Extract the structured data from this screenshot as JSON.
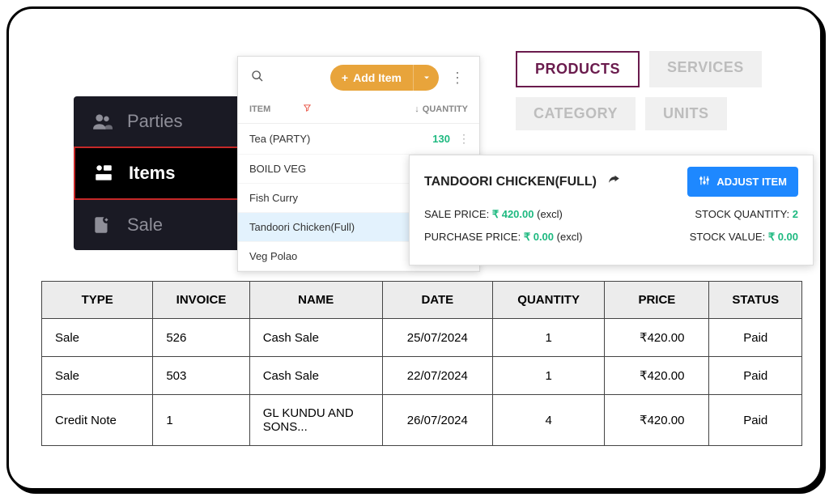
{
  "sidebar": {
    "items": [
      {
        "label": "Parties"
      },
      {
        "label": "Items"
      },
      {
        "label": "Sale"
      }
    ]
  },
  "itemPanel": {
    "addLabel": "Add Item",
    "headers": {
      "item": "ITEM",
      "quantity": "QUANTITY"
    },
    "rows": [
      {
        "name": "Tea (PARTY)",
        "qty": "130"
      },
      {
        "name": "BOILD VEG",
        "qty": ""
      },
      {
        "name": "Fish Curry",
        "qty": ""
      },
      {
        "name": "Tandoori Chicken(Full)",
        "qty": ""
      },
      {
        "name": "Veg Polao",
        "qty": ""
      }
    ]
  },
  "tabs": {
    "products": "PRODUCTS",
    "services": "SERVICES",
    "category": "CATEGORY",
    "units": "UNITS"
  },
  "detail": {
    "title": "TANDOORI CHICKEN(FULL)",
    "adjust": "ADJUST ITEM",
    "salePriceLabel": "SALE PRICE:",
    "salePrice": "₹ 420.00",
    "saleSuffix": "(excl)",
    "stockQtyLabel": "STOCK QUANTITY:",
    "stockQty": "2",
    "purchasePriceLabel": "PURCHASE PRICE:",
    "purchasePrice": "₹ 0.00",
    "purchaseSuffix": "(excl)",
    "stockValueLabel": "STOCK VALUE:",
    "stockValue": "₹ 0.00"
  },
  "txTable": {
    "headers": {
      "type": "TYPE",
      "invoice": "INVOICE",
      "name": "NAME",
      "date": "DATE",
      "quantity": "QUANTITY",
      "price": "PRICE",
      "status": "STATUS"
    },
    "rows": [
      {
        "type": "Sale",
        "invoice": "526",
        "name": "Cash Sale",
        "date": "25/07/2024",
        "quantity": "1",
        "price": "₹420.00",
        "status": "Paid"
      },
      {
        "type": "Sale",
        "invoice": "503",
        "name": "Cash Sale",
        "date": "22/07/2024",
        "quantity": "1",
        "price": "₹420.00",
        "status": "Paid"
      },
      {
        "type": "Credit Note",
        "invoice": "1",
        "name": "GL KUNDU AND SONS...",
        "date": "26/07/2024",
        "quantity": "4",
        "price": "₹420.00",
        "status": "Paid"
      }
    ]
  }
}
